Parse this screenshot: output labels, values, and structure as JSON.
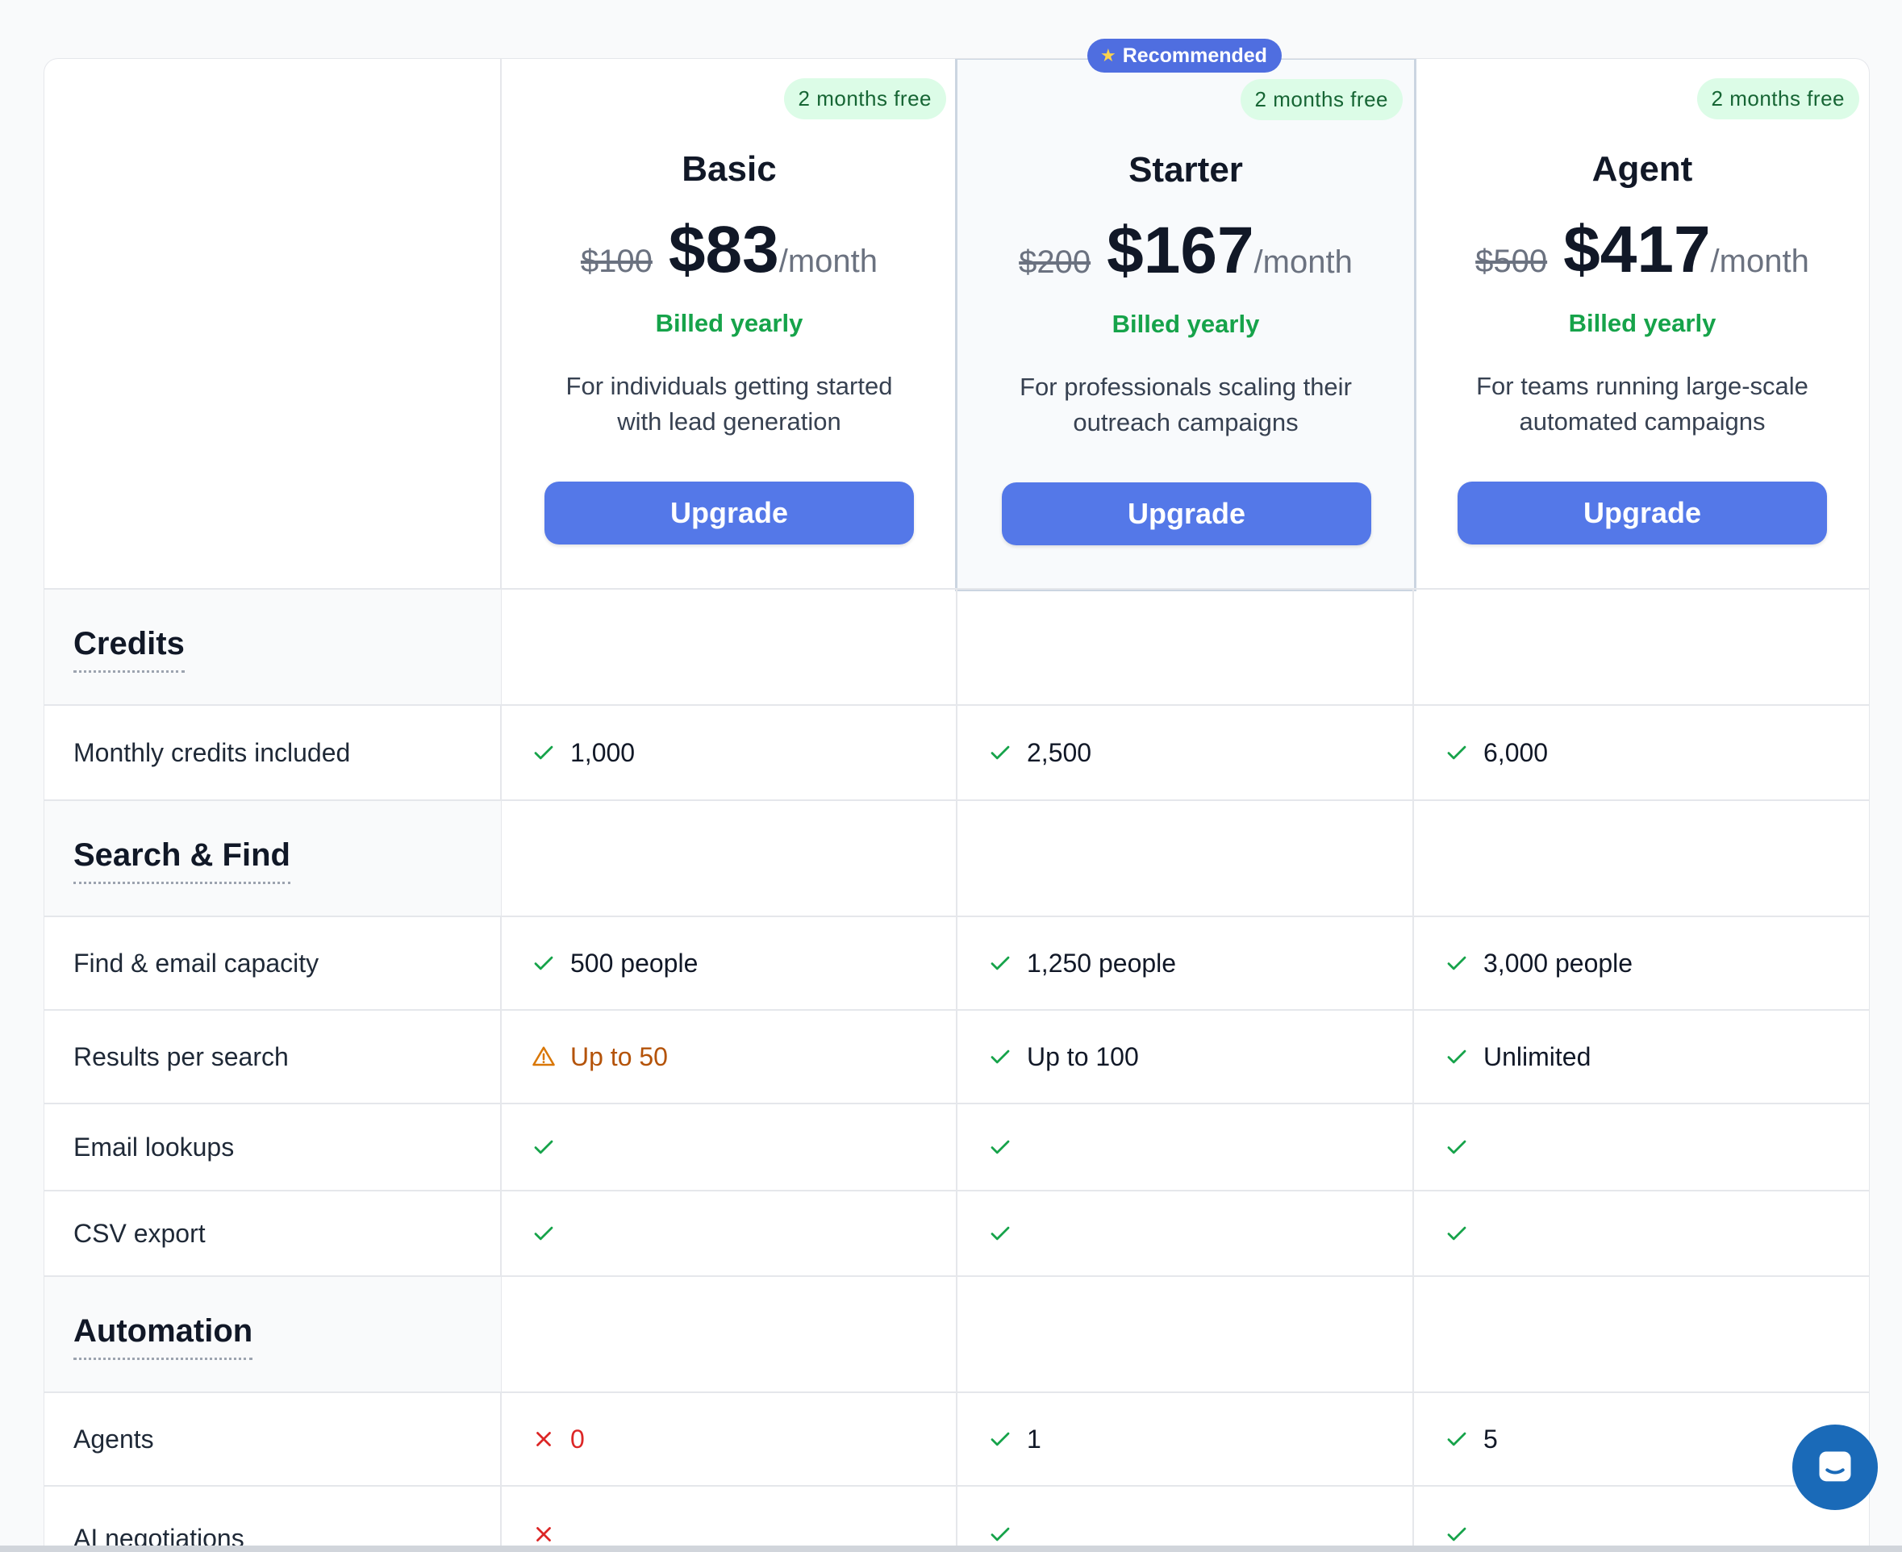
{
  "recommended_label": "Recommended",
  "plans": [
    {
      "name": "Basic",
      "badge": "2 months free",
      "old_price": "$100",
      "price": "$83",
      "period": "/month",
      "billing": "Billed yearly",
      "description": "For individuals getting started with lead generation",
      "cta": "Upgrade"
    },
    {
      "name": "Starter",
      "badge": "2 months free",
      "old_price": "$200",
      "price": "$167",
      "period": "/month",
      "billing": "Billed yearly",
      "description": "For professionals scaling their outreach campaigns",
      "cta": "Upgrade"
    },
    {
      "name": "Agent",
      "badge": "2 months free",
      "old_price": "$500",
      "price": "$417",
      "period": "/month",
      "billing": "Billed yearly",
      "description": "For teams running large-scale automated campaigns",
      "cta": "Upgrade"
    }
  ],
  "sections": {
    "credits": "Credits",
    "search": "Search & Find",
    "automation": "Automation"
  },
  "features": {
    "monthly_credits": {
      "label": "Monthly credits included",
      "values": [
        "1,000",
        "2,500",
        "6,000"
      ],
      "status": [
        "check",
        "check",
        "check"
      ]
    },
    "find_email": {
      "label": "Find & email capacity",
      "values": [
        "500 people",
        "1,250 people",
        "3,000 people"
      ],
      "status": [
        "check",
        "check",
        "check"
      ]
    },
    "results": {
      "label": "Results per search",
      "values": [
        "Up to 50",
        "Up to 100",
        "Unlimited"
      ],
      "status": [
        "warning",
        "check",
        "check"
      ]
    },
    "email_lookups": {
      "label": "Email lookups",
      "status": [
        "check",
        "check",
        "check"
      ]
    },
    "csv_export": {
      "label": "CSV export",
      "status": [
        "check",
        "check",
        "check"
      ]
    },
    "agents": {
      "label": "Agents",
      "values": [
        "0",
        "1",
        "5"
      ],
      "status": [
        "cross",
        "check",
        "check"
      ]
    },
    "ai_negotiations": {
      "label": "AI negotiations",
      "status": [
        "cross",
        "check",
        "check"
      ]
    }
  },
  "colors": {
    "accent": "#5478e8",
    "check": "#16a34a",
    "warning": "#d97706",
    "cross": "#dc2626",
    "badge_bg": "#dcfce7"
  }
}
